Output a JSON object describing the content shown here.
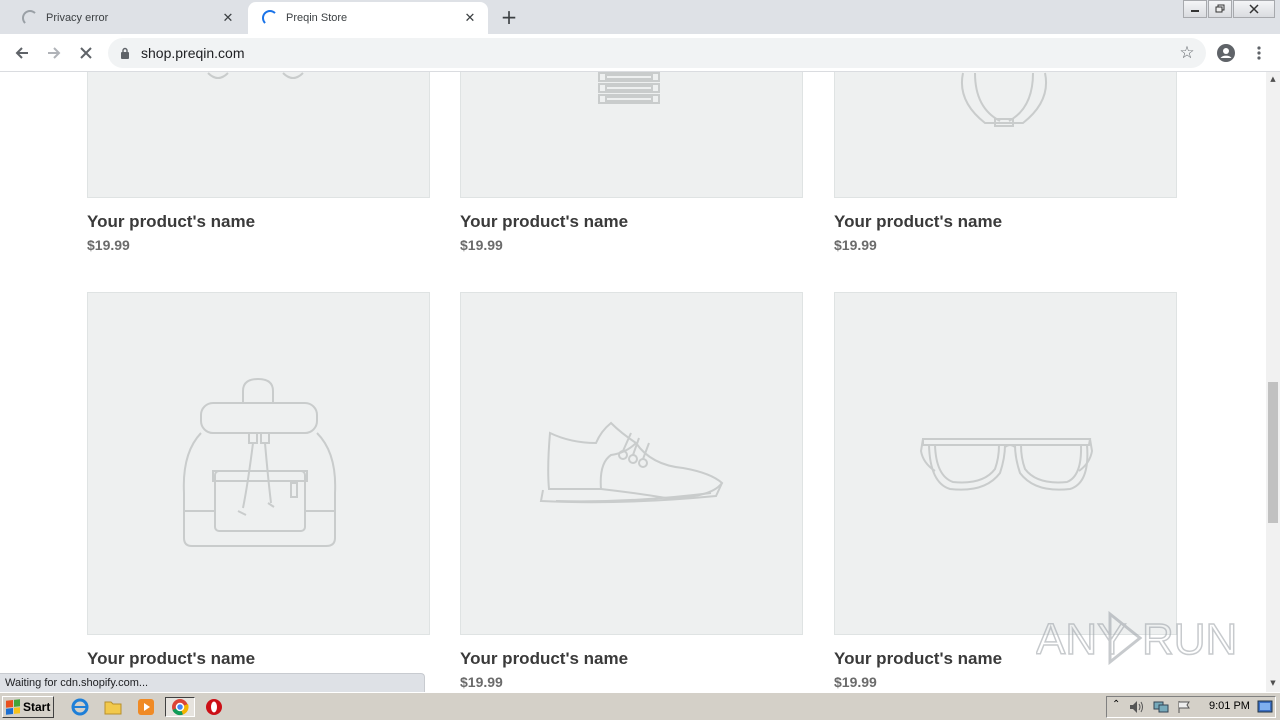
{
  "browser": {
    "tabs": [
      {
        "title": "Privacy error",
        "active": false,
        "loading": true
      },
      {
        "title": "Preqin Store",
        "active": true,
        "loading": true
      }
    ],
    "new_tab_icon": "plus-icon",
    "address": "shop.preqin.com",
    "status_text": "Waiting for cdn.shopify.com..."
  },
  "store": {
    "products": [
      {
        "name": "Your product's name",
        "price": "$19.99",
        "image": "partial-product-illustration"
      },
      {
        "name": "Your product's name",
        "price": "$19.99",
        "image": "partial-product-illustration"
      },
      {
        "name": "Your product's name",
        "price": "$19.99",
        "image": "partial-product-illustration"
      },
      {
        "name": "Your product's name",
        "price": "",
        "image": "backpack-illustration"
      },
      {
        "name": "Your product's name",
        "price": "$19.99",
        "image": "sneaker-illustration"
      },
      {
        "name": "Your product's name",
        "price": "$19.99",
        "image": "sunglasses-illustration"
      }
    ]
  },
  "watermark": {
    "text": "ANY RUN"
  },
  "taskbar": {
    "start_label": "Start",
    "clock": "9:01 PM",
    "apps": [
      "ie-icon",
      "folder-icon",
      "media-player-icon",
      "chrome-icon",
      "opera-icon"
    ]
  },
  "colors": {
    "tabstrip": "#dee1e6",
    "card_bg": "#eef0f0",
    "product_name": "#3a3a3a",
    "price": "#6b6b6b",
    "spinner": "#1a73e8",
    "taskbar": "#d4d0c8"
  }
}
